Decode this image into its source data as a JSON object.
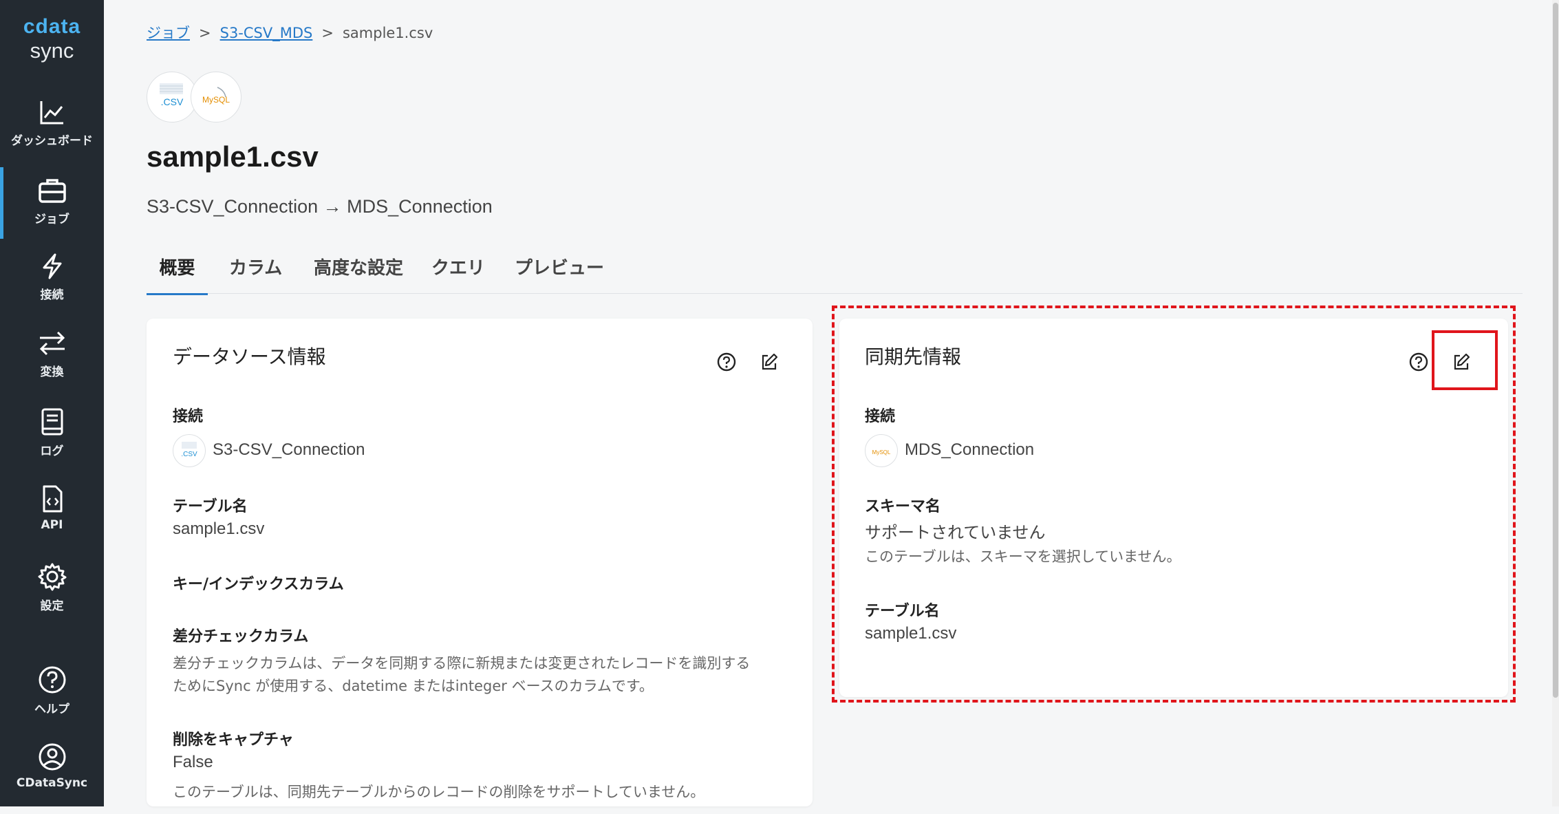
{
  "app": {
    "logo_top": "cdata",
    "logo_bottom": "sync"
  },
  "sidebar": {
    "items": [
      {
        "label": "ダッシュボード",
        "icon": "chart-line-icon"
      },
      {
        "label": "ジョブ",
        "icon": "briefcase-icon",
        "active": true
      },
      {
        "label": "接続",
        "icon": "lightning-icon"
      },
      {
        "label": "変換",
        "icon": "arrows-exchange-icon"
      },
      {
        "label": "ログ",
        "icon": "book-icon"
      },
      {
        "label": "API",
        "icon": "code-file-icon"
      },
      {
        "label": "設定",
        "icon": "gear-icon"
      }
    ],
    "bottom": [
      {
        "label": "ヘルプ",
        "icon": "help-circle-icon"
      },
      {
        "label": "CDataSync",
        "icon": "user-circle-icon"
      }
    ]
  },
  "breadcrumb": {
    "items": [
      "ジョブ",
      "S3-CSV_MDS",
      "sample1.csv"
    ],
    "sep": ">"
  },
  "header": {
    "csv_badge": ".CSV",
    "mysql_badge": "MySQL",
    "title": "sample1.csv",
    "subtitle": "S3-CSV_Connection → MDS_Connection"
  },
  "tabs": [
    "概要",
    "カラム",
    "高度な設定",
    "クエリ",
    "プレビュー"
  ],
  "source_card": {
    "title": "データソース情報",
    "connection_label": "接続",
    "connection_value": "S3-CSV_Connection",
    "table_label": "テーブル名",
    "table_value": "sample1.csv",
    "key_label": "キー/インデックスカラム",
    "diff_label": "差分チェックカラム",
    "diff_desc_1": "差分チェックカラムは、データを同期する際に新規または変更されたレコードを識別する",
    "diff_desc_2": "ためにSync が使用する、datetime またはinteger ベースのカラムです。",
    "delete_label": "削除をキャプチャ",
    "delete_value": "False",
    "delete_desc": "このテーブルは、同期先テーブルからのレコードの削除をサポートしていません。"
  },
  "dest_card": {
    "title": "同期先情報",
    "connection_label": "接続",
    "connection_value": "MDS_Connection",
    "schema_label": "スキーマ名",
    "schema_value": "サポートされていません",
    "schema_desc": "このテーブルは、スキーマを選択していません。",
    "table_label": "テーブル名",
    "table_value": "sample1.csv"
  },
  "colors": {
    "accent": "#2679c8",
    "sidebar": "#232a31",
    "highlight": "#e0151b"
  }
}
